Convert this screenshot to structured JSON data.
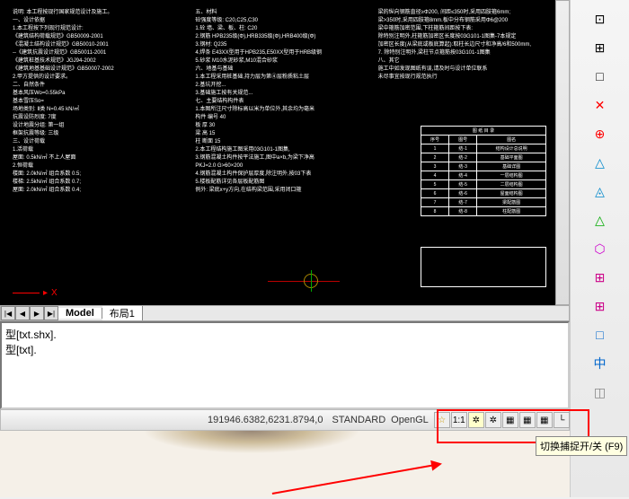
{
  "drawing": {
    "col1": [
      "说明: 本工程按现行国家规范设计及施工。",
      "一、设计依据",
      "1.本工程按下列现行规范设计:",
      "  《建筑结构荷载规范》GB50009-2001",
      "  《混凝土结构设计规范》GB50010-2001",
      "--《建筑抗震设计规范》GB50011-2001",
      "  《建筑桩基技术规范》JGJ94-2002",
      "  《建筑地基基础设计规范》GB50007-2002",
      "2.甲方提供的设计要求。",
      "二、自然条件",
      "基本风压Wo=0.55kPa",
      "基本雪压So=",
      "场地类别: Ⅱ类  N=0.45 kN/㎡",
      "抗震设防烈度: 7度",
      "设计地震分组: 第一组",
      "框架抗震等级: 三级",
      "三、设计荷载",
      "1.活荷载",
      "  屋面: 0.5kN/㎡ 不上人屋面",
      "2.恒荷载",
      "  楼面: 2.0kN/㎡ 组合系数 0.5;",
      "  楼梯: 2.5kN/㎡ 组合系数 0.7;",
      "  屋面: 2.0kN/㎡ 组合系数 0.4;"
    ],
    "col2": [
      "五、材料",
      "  砼强度等级: C20,C25,C30",
      "  1.砼 墙、梁、板、柱: C20",
      "  2.钢筋 HPB235级(Φ),HRB335级(Φ),HRB400级(Φ)",
      "  3.钢材: Q235",
      "  4.焊条 E43XX型用于HPB235,E50XX型用于HRB级钢",
      "  5.砂浆 M10水泥砂浆,M10混合砂浆",
      "六、地基与基础",
      "  1.本工程采用桩基础,持力层为第④层粉质粘土层",
      "  2.基坑开挖...",
      "  3.基础施工按有关规范...",
      "七、主要结构构件表",
      "  1.本图所注尺寸除标高以米为单位外,其余均为毫米",
      "  构件  编号      40",
      "  板    厚        30",
      "  梁    高        15",
      "  柱    断面      15",
      "  2.本工程结构施工图采用03G101-1图集,",
      "  3.钢筋混凝土构件按平法施工,图中a×b,为梁下净高",
      "    PKJ=2.0 G>60×200",
      "  4.钢筋混凝土构件保护层厚度,除注明外,按03下表",
      "  5.楼板配筋详见各层板配筋图",
      "  例外: 梁底x+y方向,在结构梁范围,采用闭口箍"
    ],
    "col3": [
      "梁的纵向钢筋直径≥Φ200, 间距≤350时,采用四肢箍6mm;",
      "梁>350时,采用四肢箍8mm.板中分布钢筋采用Φ6@200",
      "梁中箍筋加密范围,下柱箍筋间距按下表:",
      "  除特别注明外,柱箍筋加密区长度按03G101-1图集-7本规定",
      "  加密区长度(从梁底或板底算起):取柱长边尺寸和净高/6和500mm,",
      "7. 除特别注明外,梁柱节点箍筋按03G101-1图集",
      "八、其它",
      "  施工中如发现图纸有误,请及时与设计单位联系",
      "  未尽事宜按现行规范执行"
    ],
    "tableTitle": "图 纸 目 录",
    "tableHead": [
      "序号",
      "图号",
      "图名"
    ],
    "tableRows": [
      [
        "1",
        "结-1",
        "结构设计总说明"
      ],
      [
        "2",
        "结-2",
        "基础平面图"
      ],
      [
        "3",
        "结-3",
        "基础详图"
      ],
      [
        "4",
        "结-4",
        "一层结构图"
      ],
      [
        "5",
        "结-5",
        "二层结构图"
      ],
      [
        "6",
        "结-6",
        "屋面结构图"
      ],
      [
        "7",
        "结-7",
        "梁配筋图"
      ],
      [
        "8",
        "结-8",
        "柱配筋图"
      ]
    ]
  },
  "ucs": {
    "x": "X"
  },
  "tabs": {
    "nav": [
      "|◀",
      "◀",
      "▶",
      "▶|"
    ],
    "model": "Model",
    "layout1": "布局1"
  },
  "cmd": {
    "line1": "型[txt.shx].",
    "line2": "型[txt]."
  },
  "status": {
    "coords": "191946.6382,6231.8794,0",
    "standard": "STANDARD",
    "opengl": "OpenGL",
    "scale": "1:1"
  },
  "sbicons": {
    "star": "☆",
    "wheel": "✲",
    "wheel2": "✲",
    "grid": "▦",
    "grid2": "▦",
    "grid3": "▦",
    "corner": "└",
    "dots": "⋮"
  },
  "rightIcons": {
    "i1": "⊡",
    "i2": "⊞",
    "i3": "□",
    "i4": "✕",
    "i5": "⊕",
    "i6": "△",
    "i7": "◬",
    "i8": "△",
    "i9": "⬡",
    "i10": "⊞",
    "i11": "⊞",
    "i12": "□",
    "i13": "中",
    "i14": "◫"
  },
  "tooltip": {
    "text": "切换捕捉开/关",
    "key": "(F9)"
  }
}
